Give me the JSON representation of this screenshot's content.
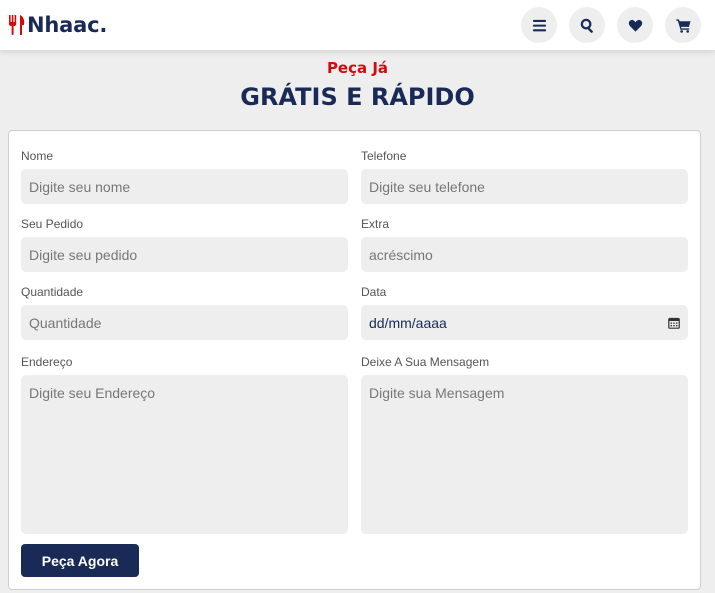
{
  "header": {
    "logo_text": "Nhaac.",
    "icons": [
      "menu-icon",
      "search-icon",
      "heart-icon",
      "cart-icon"
    ]
  },
  "order": {
    "sub_heading": "Peça Já",
    "title": "GRÁTIS E RÁPIDO",
    "fields": {
      "name": {
        "label": "Nome",
        "placeholder": "Digite seu nome"
      },
      "phone": {
        "label": "Telefone",
        "placeholder": "Digite seu telefone"
      },
      "order_item": {
        "label": "Seu Pedido",
        "placeholder": "Digite seu pedido"
      },
      "extra": {
        "label": "Extra",
        "placeholder": "acréscimo"
      },
      "quantity": {
        "label": "Quantidade",
        "placeholder": "Quantidade"
      },
      "date": {
        "label": "Data",
        "value": "dd/mm/aaaa"
      },
      "address": {
        "label": "Endereço",
        "placeholder": "Digite seu Endereço"
      },
      "message": {
        "label": "Deixe A Sua Mensagem",
        "placeholder": "Digite sua Mensagem"
      }
    },
    "submit_label": "Peça Agora"
  },
  "colors": {
    "brand": "#192a56",
    "accent": "#d20b0b",
    "background": "#eeeeee"
  }
}
